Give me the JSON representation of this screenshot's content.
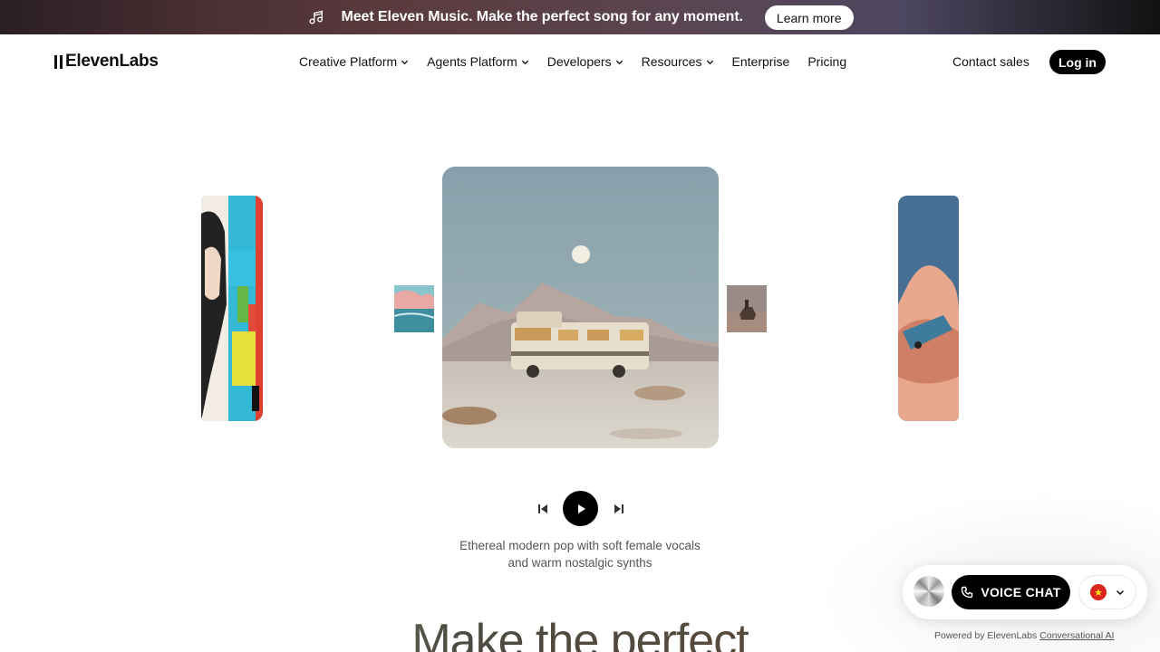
{
  "banner": {
    "icon": "music-note-icon",
    "text": "Meet Eleven Music. Make the perfect song for any moment.",
    "button_label": "Learn more"
  },
  "header": {
    "logo": "ElevenLabs",
    "nav": [
      {
        "label": "Creative Platform",
        "dropdown": true
      },
      {
        "label": "Agents Platform",
        "dropdown": true
      },
      {
        "label": "Developers",
        "dropdown": true
      },
      {
        "label": "Resources",
        "dropdown": true
      },
      {
        "label": "Enterprise",
        "dropdown": false
      },
      {
        "label": "Pricing",
        "dropdown": false
      }
    ],
    "contact_label": "Contact sales",
    "login_label": "Log in"
  },
  "player": {
    "prev_icon": "skip-back-icon",
    "play_icon": "play-icon",
    "next_icon": "skip-forward-icon",
    "caption_line1": "Ethereal modern pop with soft female vocals",
    "caption_line2": "and warm nostalgic synths"
  },
  "hero": {
    "title": "Make the perfect"
  },
  "widget": {
    "voice_chat_label": "VOICE CHAT",
    "phone_icon": "phone-icon",
    "language_flag": "vietnam-flag-icon",
    "powered_prefix": "Powered by ElevenLabs ",
    "powered_link": "Conversational AI"
  },
  "colors": {
    "accent": "#000000",
    "banner_start": "#2a1f24",
    "banner_mid": "#5a4652",
    "caption": "#555555"
  }
}
